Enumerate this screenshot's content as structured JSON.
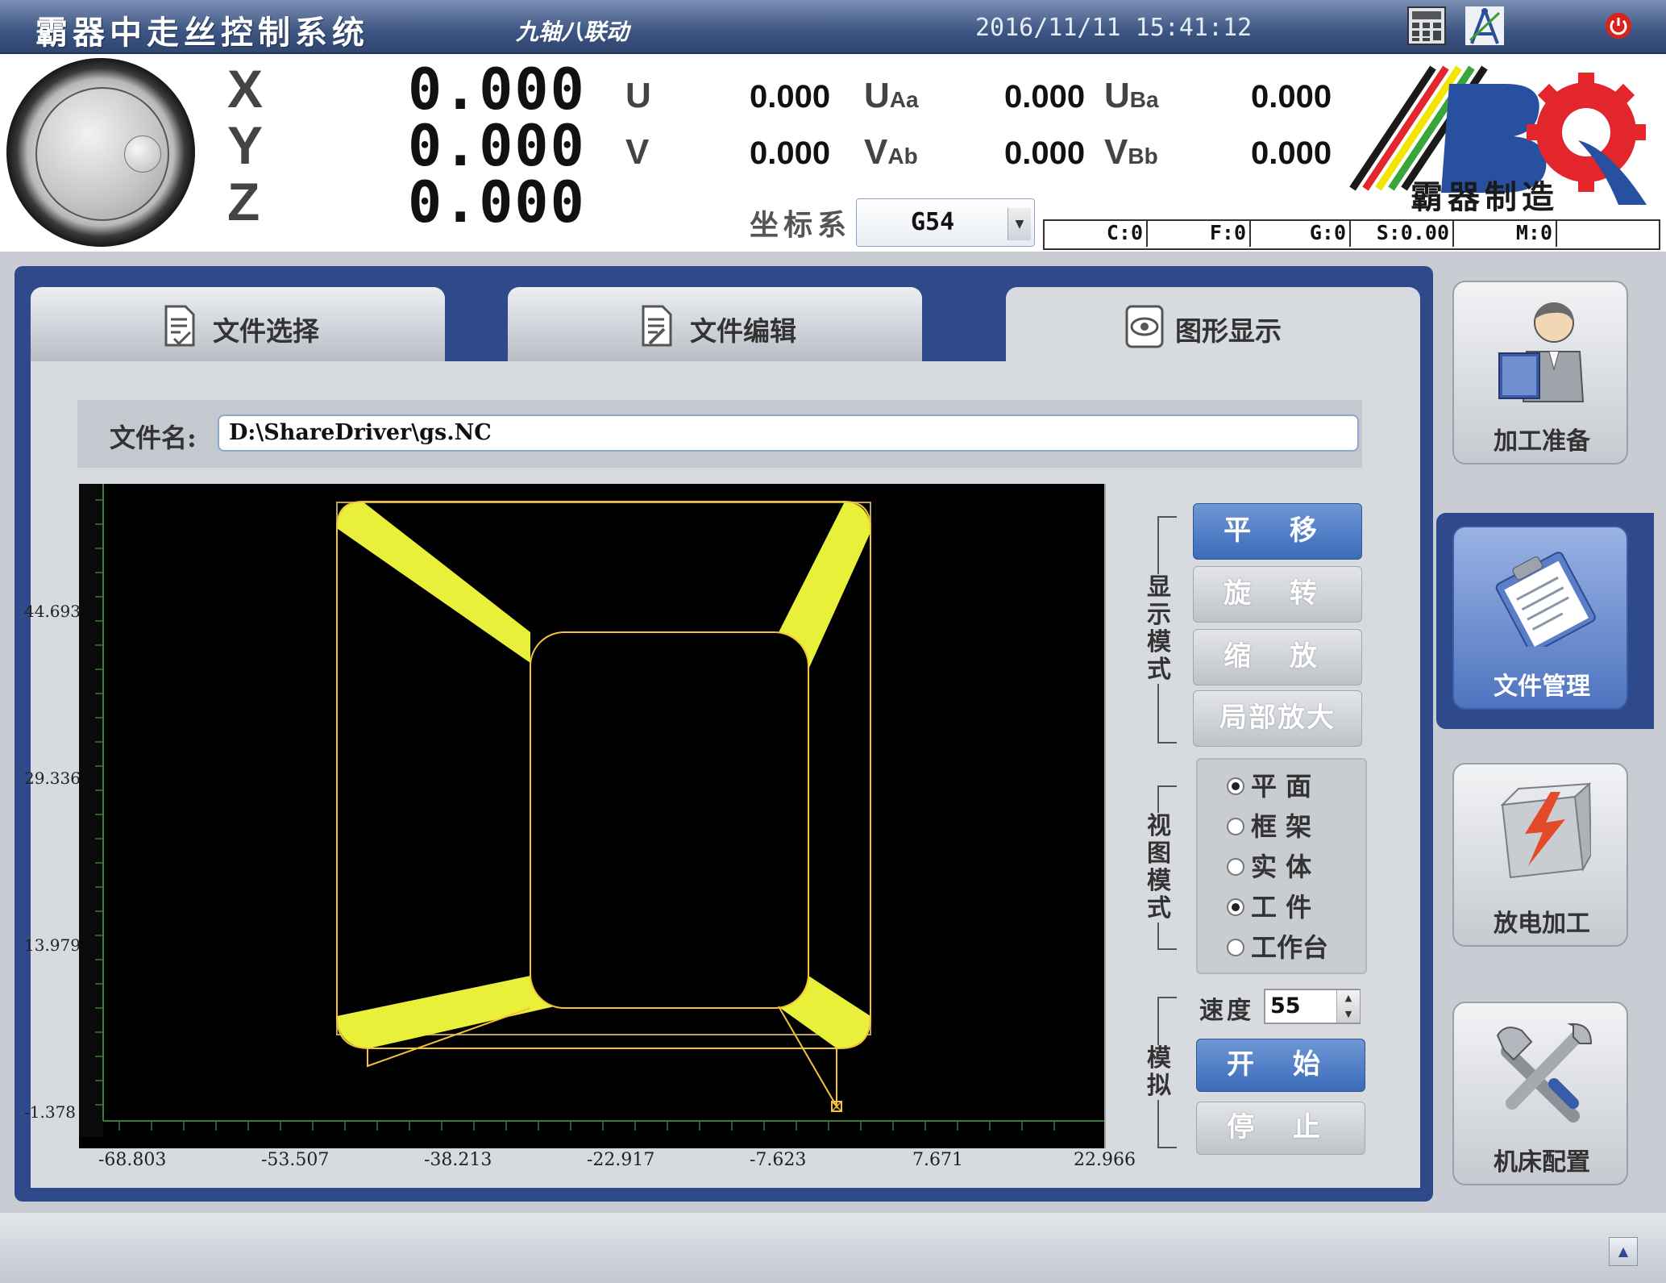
{
  "titlebar": {
    "title": "霸器中走丝控制系统",
    "subtitle": "九轴八联动",
    "datetime": "2016/11/11 15:41:12",
    "icons": [
      "calculator-icon",
      "drafting-compass-icon",
      "power-icon"
    ]
  },
  "coords": {
    "axes": [
      {
        "name": "X",
        "value": "0.000"
      },
      {
        "name": "Y",
        "value": "0.000"
      },
      {
        "name": "Z",
        "value": "0.000"
      }
    ],
    "aux": [
      {
        "name": "U",
        "value": "0.000"
      },
      {
        "name": "V",
        "value": "0.000"
      }
    ],
    "uv_a": [
      {
        "name": "U",
        "sub": "Aa",
        "value": "0.000"
      },
      {
        "name": "V",
        "sub": "Ab",
        "value": "0.000"
      }
    ],
    "uv_b": [
      {
        "name": "U",
        "sub": "Ba",
        "value": "0.000"
      },
      {
        "name": "V",
        "sub": "Bb",
        "value": "0.000"
      }
    ],
    "system_label": "坐标系",
    "system_value": "G54"
  },
  "status": {
    "c": "C:0",
    "f": "F:0",
    "g": "G:0",
    "s": "S:0.00",
    "m": "M:0"
  },
  "logo": {
    "text": "霸器制造",
    "colors": [
      "#000000",
      "#e3262b",
      "#f2e600",
      "#3aa53b",
      "#2850a0"
    ]
  },
  "tabs": [
    {
      "label": "文件选择",
      "icon": "document-check-icon"
    },
    {
      "label": "文件编辑",
      "icon": "document-edit-icon"
    },
    {
      "label": "图形显示",
      "icon": "eye-icon",
      "active": true
    }
  ],
  "file": {
    "label": "文件名:",
    "value": "D:\\ShareDriver\\gs.NC"
  },
  "plot": {
    "y_ticks": [
      "44.693",
      "29.336",
      "13.979",
      "-1.378"
    ],
    "x_ticks": [
      "-68.803",
      "-53.507",
      "-38.213",
      "-22.917",
      "-7.623",
      "7.671",
      "22.966"
    ],
    "colors": {
      "background": "#000000",
      "fill": "#e8f03a",
      "outline": "#f5c33a",
      "axis": "#3a7a3a"
    }
  },
  "display_mode": {
    "label": "显示模式",
    "buttons": [
      {
        "label": "平 移",
        "active": true
      },
      {
        "label": "旋 转",
        "active": false
      },
      {
        "label": "缩 放",
        "active": false
      },
      {
        "label": "局部放大",
        "active": false
      }
    ]
  },
  "view_mode": {
    "label": "视图模式",
    "options": [
      {
        "label": "平 面",
        "checked": true
      },
      {
        "label": "框 架",
        "checked": false
      },
      {
        "label": "实 体",
        "checked": false
      },
      {
        "label": "工 件",
        "checked": true
      },
      {
        "label": "工作台",
        "checked": false
      }
    ]
  },
  "simulate": {
    "label": "模拟",
    "speed_label": "速度",
    "speed_value": "55",
    "start_label": "开 始",
    "stop_label": "停 止"
  },
  "nav": [
    {
      "label": "加工准备",
      "icon": "worker-icon",
      "active": false
    },
    {
      "label": "文件管理",
      "icon": "clipboard-icon",
      "active": true
    },
    {
      "label": "放电加工",
      "icon": "lightning-box-icon",
      "active": false
    },
    {
      "label": "机床配置",
      "icon": "tools-icon",
      "active": false
    }
  ]
}
